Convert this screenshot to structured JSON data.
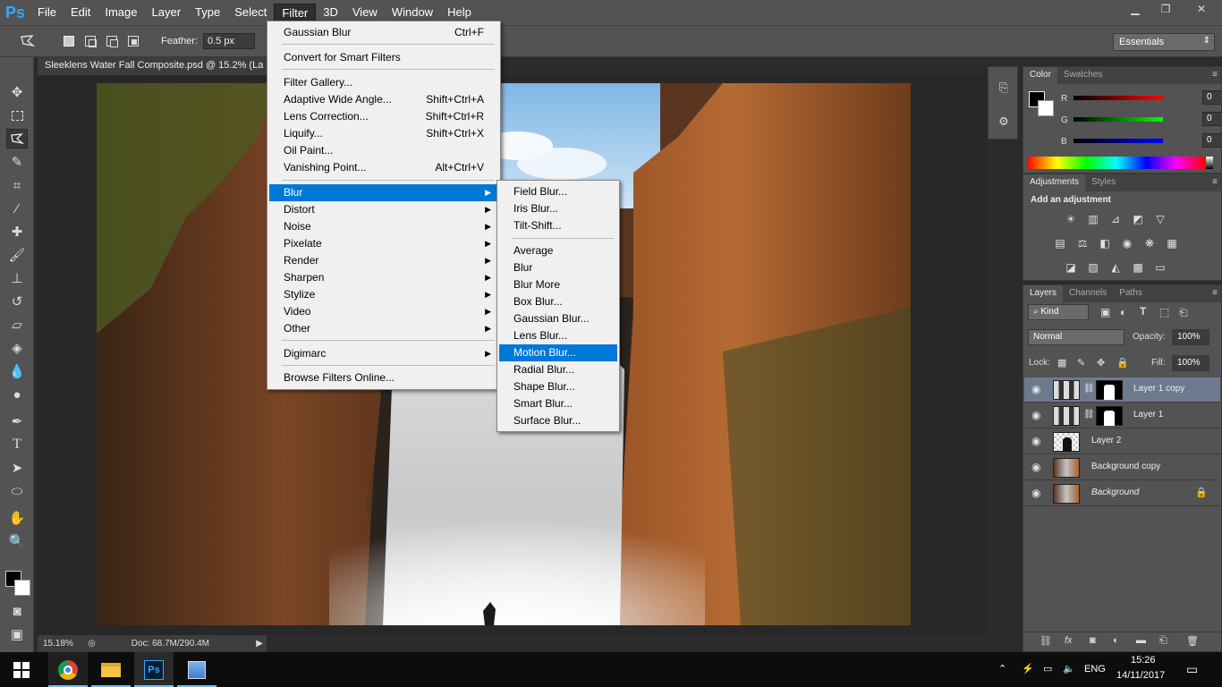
{
  "app": {
    "logo": "Ps",
    "menu": [
      "File",
      "Edit",
      "Image",
      "Layer",
      "Type",
      "Select",
      "Filter",
      "3D",
      "View",
      "Window",
      "Help"
    ],
    "active_menu": "Filter"
  },
  "window_controls": {
    "minimize": "▁",
    "restore": "❐",
    "close": "✕"
  },
  "options_bar": {
    "feather_label": "Feather:",
    "feather_value": "0.5 px",
    "workspace": "Essentials"
  },
  "document": {
    "tab_title": "Sleeklens Water Fall Composite.psd @ 15.2% (La",
    "zoom": "15.18%",
    "doc_info": "Doc: 68.7M/290.4M"
  },
  "filter_menu": {
    "items": [
      {
        "label": "Gaussian Blur",
        "shortcut": "Ctrl+F"
      },
      {
        "label": "Convert for Smart Filters",
        "shortcut": ""
      },
      {
        "label": "Filter Gallery...",
        "shortcut": ""
      },
      {
        "label": "Adaptive Wide Angle...",
        "shortcut": "Shift+Ctrl+A"
      },
      {
        "label": "Lens Correction...",
        "shortcut": "Shift+Ctrl+R"
      },
      {
        "label": "Liquify...",
        "shortcut": "Shift+Ctrl+X"
      },
      {
        "label": "Oil Paint...",
        "shortcut": ""
      },
      {
        "label": "Vanishing Point...",
        "shortcut": "Alt+Ctrl+V"
      },
      {
        "label": "Blur",
        "shortcut": ""
      },
      {
        "label": "Distort",
        "shortcut": ""
      },
      {
        "label": "Noise",
        "shortcut": ""
      },
      {
        "label": "Pixelate",
        "shortcut": ""
      },
      {
        "label": "Render",
        "shortcut": ""
      },
      {
        "label": "Sharpen",
        "shortcut": ""
      },
      {
        "label": "Stylize",
        "shortcut": ""
      },
      {
        "label": "Video",
        "shortcut": ""
      },
      {
        "label": "Other",
        "shortcut": ""
      },
      {
        "label": "Digimarc",
        "shortcut": ""
      },
      {
        "label": "Browse Filters Online...",
        "shortcut": ""
      }
    ],
    "highlighted": "Blur"
  },
  "blur_submenu": {
    "items": [
      "Field Blur...",
      "Iris Blur...",
      "Tilt-Shift...",
      "Average",
      "Blur",
      "Blur More",
      "Box Blur...",
      "Gaussian Blur...",
      "Lens Blur...",
      "Motion Blur...",
      "Radial Blur...",
      "Shape Blur...",
      "Smart Blur...",
      "Surface Blur..."
    ],
    "highlighted": "Motion Blur..."
  },
  "color_panel": {
    "tabs": [
      "Color",
      "Swatches"
    ],
    "channels": [
      {
        "label": "R",
        "value": "0",
        "color": "#ff0000"
      },
      {
        "label": "G",
        "value": "0",
        "color": "#00ff00"
      },
      {
        "label": "B",
        "value": "0",
        "color": "#0000ff"
      }
    ]
  },
  "adjustments_panel": {
    "tabs": [
      "Adjustments",
      "Styles"
    ],
    "heading": "Add an adjustment",
    "icons": [
      "brightness-icon",
      "levels-icon",
      "curves-icon",
      "exposure-icon",
      "vibrance-icon",
      "hue-saturation-icon",
      "color-balance-icon",
      "black-white-icon",
      "photo-filter-icon",
      "channel-mixer-icon",
      "color-lookup-icon",
      "invert-icon",
      "posterize-icon",
      "threshold-icon",
      "gradient-map-icon",
      "selective-color-icon"
    ]
  },
  "layers_panel": {
    "tabs": [
      "Layers",
      "Channels",
      "Paths"
    ],
    "filter_kind": "Kind",
    "blend_mode": "Normal",
    "opacity_label": "Opacity:",
    "opacity": "100%",
    "lock_label": "Lock:",
    "fill_label": "Fill:",
    "fill": "100%",
    "layers": [
      {
        "name": "Layer 1 copy",
        "selected": true
      },
      {
        "name": "Layer 1",
        "selected": false
      },
      {
        "name": "Layer 2",
        "selected": false
      },
      {
        "name": "Background copy",
        "selected": false
      },
      {
        "name": "Background",
        "selected": false
      }
    ]
  },
  "taskbar": {
    "language": "ENG",
    "time": "15:26",
    "date": "14/11/2017"
  }
}
